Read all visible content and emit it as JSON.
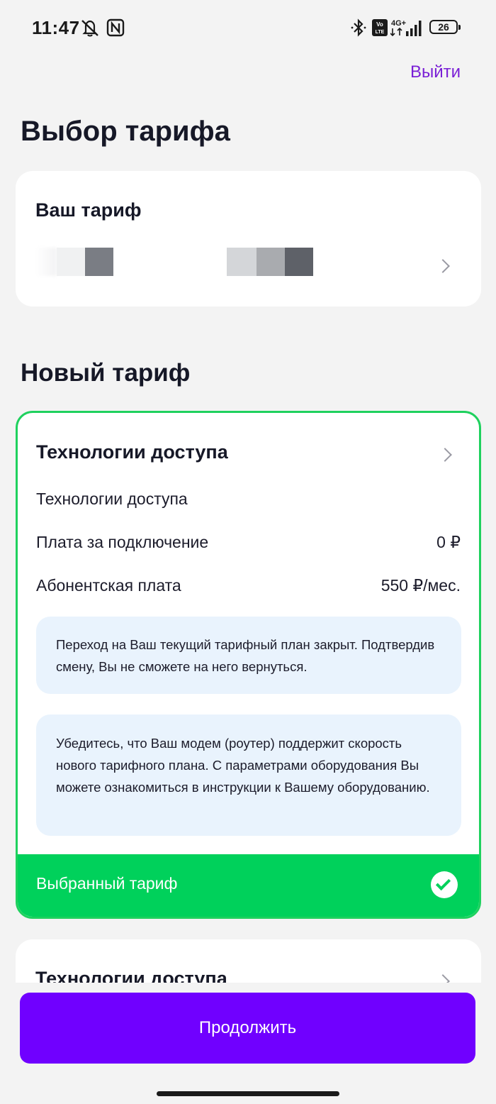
{
  "status_bar": {
    "time": "11:47",
    "battery": "26",
    "network": "4G+",
    "volte": "Vo LTE",
    "icons": [
      "mute-icon",
      "nfc-icon",
      "bluetooth-icon",
      "volte-icon",
      "signal-icon",
      "battery-icon"
    ]
  },
  "header": {
    "logout_label": "Выйти",
    "title": "Выбор тарифа"
  },
  "current_tariff": {
    "title": "Ваш тариф",
    "name_blurred": true
  },
  "new_tariff": {
    "section_title": "Новый тариф",
    "selected_card": {
      "title": "Технологии доступа",
      "subtitle": "Технологии доступа",
      "rows": [
        {
          "label": "Плата за подключение",
          "value": "0 ₽"
        },
        {
          "label": "Абонентская плата",
          "value": "550 ₽/мес."
        }
      ],
      "notices": [
        "Переход на Ваш текущий тарифный план закрыт. Подтвердив смену, Вы не сможете на него вернуться.",
        "Убедитесь, что Ваш модем (роутер) поддержит скорость нового тарифного плана. С параметрами оборудования Вы можете ознакомиться в инструкции к Вашему оборудованию."
      ],
      "selected_label": "Выбранный тариф"
    },
    "next_card": {
      "title": "Технологии доступа"
    }
  },
  "footer": {
    "continue_label": "Продолжить"
  },
  "colors": {
    "accent_purple": "#7000ff",
    "logout_purple": "#7a1fd6",
    "selected_green": "#00d15b",
    "border_green": "#1fd15e",
    "notice_bg": "#e9f3fd",
    "page_bg": "#f3f3f3"
  }
}
